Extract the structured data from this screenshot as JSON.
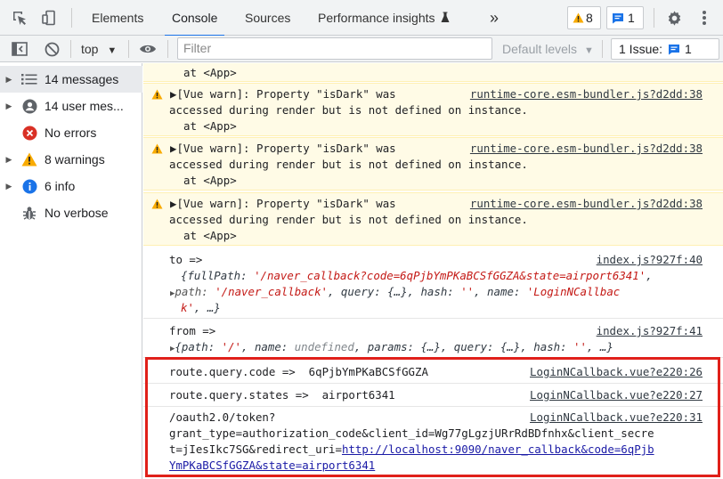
{
  "tabs": {
    "elements": "Elements",
    "console": "Console",
    "sources": "Sources",
    "performance": "Performance insights",
    "more": "»"
  },
  "badges": {
    "warnings_count": "8",
    "messages_count": "1"
  },
  "toolbar": {
    "context": "top",
    "filter_placeholder": "Filter",
    "levels": "Default levels",
    "issues_label": "1 Issue:",
    "issues_count": "1"
  },
  "sidebar": {
    "items": [
      {
        "label": "14 messages",
        "icon": "list-icon"
      },
      {
        "label": "14 user mes...",
        "icon": "user-icon"
      },
      {
        "label": "No errors",
        "icon": "error-icon"
      },
      {
        "label": "8 warnings",
        "icon": "warning-icon"
      },
      {
        "label": "6 info",
        "icon": "info-icon"
      },
      {
        "label": "No verbose",
        "icon": "bug-icon"
      }
    ]
  },
  "console": {
    "top_line": "at <App>",
    "warnings": [
      {
        "l1": "▶[Vue warn]: Property \"isDark\" was",
        "l2": "accessed during render but is not defined on instance.",
        "l3": "at <App>",
        "source": "runtime-core.esm-bundler.js?d2dd:38"
      },
      {
        "l1": "▶[Vue warn]: Property \"isDark\" was",
        "l2": "accessed during render but is not defined on instance.",
        "l3": "at <App>",
        "source": "runtime-core.esm-bundler.js?d2dd:38"
      },
      {
        "l1": "▶[Vue warn]: Property \"isDark\" was",
        "l2": "accessed during render but is not defined on instance.",
        "l3": "at <App>",
        "source": "runtime-core.esm-bundler.js?d2dd:38"
      }
    ],
    "to": {
      "label": "to =>",
      "source": "index.js?927f:40",
      "l1_pre": "{fullPath: ",
      "l1_val": "'/naver_callback?code=6qPjbYmPKaBCSfGGZA&state=airport6341'",
      "l1_post": ",",
      "l2_key1": "path: ",
      "l2_val1": "'/naver_callback'",
      "l2_mid": ", query: {…}, hash: ",
      "l2_val2": "''",
      "l2_mid2": ", name: ",
      "l2_val3": "'LoginNCallbac",
      "l3_val": "k'",
      "l3_post": ", …}"
    },
    "from": {
      "label": "from =>",
      "source": "index.js?927f:41",
      "l1_pre": "{path: ",
      "l1_val": "'/'",
      "l1_mid": ", name: ",
      "l1_undef": "undefined",
      "l1_mid2": ", params: {…}, query: {…}, hash: ",
      "l1_val2": "''",
      "l1_post": ", …}"
    },
    "code_line": {
      "text": "route.query.code =>  6qPjbYmPKaBCSfGGZA",
      "source": "LoginNCallback.vue?e220:26"
    },
    "states_line": {
      "text": "route.query.states =>  airport6341",
      "source": "LoginNCallback.vue?e220:27"
    },
    "token": {
      "source": "LoginNCallback.vue?e220:31",
      "l1": "/oauth2.0/token?",
      "l2": "grant_type=authorization_code&client_id=Wg77gLgzjURrRdBDfnhx&client_secre",
      "l3_pre": "t=jIesIkc7SG&redirect_uri=",
      "l3_link": "http://localhost:9090/naver_callback&code=6qPjb",
      "l4_link": "YmPKaBCSfGGZA&state=airport6341"
    }
  },
  "colors": {
    "accent": "#1a73e8",
    "warning": "#f9ab00",
    "error": "#d93025",
    "highlight": "#e0201a"
  }
}
